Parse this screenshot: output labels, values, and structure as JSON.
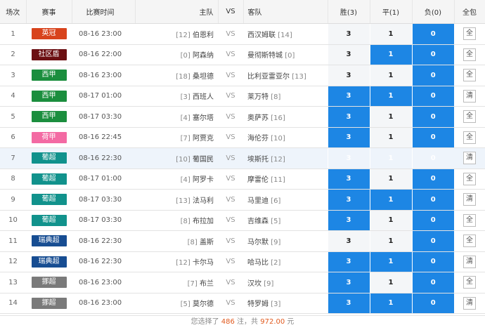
{
  "header": {
    "idx": "场次",
    "league": "赛事",
    "time": "比赛时间",
    "home": "主队",
    "vs": "VS",
    "away": "客队",
    "win": "胜(3)",
    "draw": "平(1)",
    "lose": "负(0)",
    "pack": "全包"
  },
  "colors": {
    "英冠": "#d8431c",
    "社区盾": "#6b0f12",
    "西甲": "#1b8e3e",
    "荷甲": "#f36aa3",
    "葡超": "#11928c",
    "瑞典超": "#174d92",
    "挪超": "#7a7a7a"
  },
  "rows": [
    {
      "idx": "1",
      "league": "英冠",
      "time": "08-16 23:00",
      "home_rank": "[12]",
      "home": "伯恩利",
      "vs": "VS",
      "away": "西汉姆联",
      "away_rank": "[14]",
      "w": "3",
      "d": "1",
      "l": "0",
      "sel": [
        false,
        false,
        true
      ],
      "pack": "全"
    },
    {
      "idx": "2",
      "league": "社区盾",
      "time": "08-16 22:00",
      "home_rank": "[0]",
      "home": "阿森纳",
      "vs": "VS",
      "away": "曼彻斯特城",
      "away_rank": "[0]",
      "w": "3",
      "d": "1",
      "l": "0",
      "sel": [
        false,
        true,
        true
      ],
      "pack": "全"
    },
    {
      "idx": "3",
      "league": "西甲",
      "time": "08-16 23:00",
      "home_rank": "[18]",
      "home": "桑坦德",
      "vs": "VS",
      "away": "比利亚雷亚尔",
      "away_rank": "[13]",
      "w": "3",
      "d": "1",
      "l": "0",
      "sel": [
        false,
        false,
        true
      ],
      "pack": "全"
    },
    {
      "idx": "4",
      "league": "西甲",
      "time": "08-17 01:00",
      "home_rank": "[3]",
      "home": "西班人",
      "vs": "VS",
      "away": "莱万特",
      "away_rank": "[8]",
      "w": "3",
      "d": "1",
      "l": "0",
      "sel": [
        true,
        true,
        true
      ],
      "pack": "清"
    },
    {
      "idx": "5",
      "league": "西甲",
      "time": "08-17 03:30",
      "home_rank": "[4]",
      "home": "塞尔塔",
      "vs": "VS",
      "away": "奥萨苏",
      "away_rank": "[16]",
      "w": "3",
      "d": "1",
      "l": "0",
      "sel": [
        true,
        false,
        true
      ],
      "pack": "全"
    },
    {
      "idx": "6",
      "league": "荷甲",
      "time": "08-16 22:45",
      "home_rank": "[7]",
      "home": "阿贾克",
      "vs": "VS",
      "away": "海伦芬",
      "away_rank": "[10]",
      "w": "3",
      "d": "1",
      "l": "0",
      "sel": [
        true,
        false,
        true
      ],
      "pack": "全"
    },
    {
      "idx": "7",
      "league": "葡超",
      "time": "08-16 22:30",
      "home_rank": "[10]",
      "home": "葡国民",
      "vs": "VS",
      "away": "埃斯托",
      "away_rank": "[12]",
      "w": "3",
      "d": "1",
      "l": "0",
      "sel": [
        true,
        true,
        true
      ],
      "pack": "清"
    },
    {
      "idx": "8",
      "league": "葡超",
      "time": "08-17 01:00",
      "home_rank": "[4]",
      "home": "阿罗卡",
      "vs": "VS",
      "away": "摩雷伦",
      "away_rank": "[11]",
      "w": "3",
      "d": "1",
      "l": "0",
      "sel": [
        true,
        false,
        true
      ],
      "pack": "全"
    },
    {
      "idx": "9",
      "league": "葡超",
      "time": "08-17 03:30",
      "home_rank": "[13]",
      "home": "法马利",
      "vs": "VS",
      "away": "马里迪",
      "away_rank": "[6]",
      "w": "3",
      "d": "1",
      "l": "0",
      "sel": [
        true,
        true,
        true
      ],
      "pack": "清"
    },
    {
      "idx": "10",
      "league": "葡超",
      "time": "08-17 03:30",
      "home_rank": "[8]",
      "home": "布拉加",
      "vs": "VS",
      "away": "吉维森",
      "away_rank": "[5]",
      "w": "3",
      "d": "1",
      "l": "0",
      "sel": [
        true,
        false,
        true
      ],
      "pack": "全"
    },
    {
      "idx": "11",
      "league": "瑞典超",
      "time": "08-16 22:30",
      "home_rank": "[8]",
      "home": "盖斯",
      "vs": "VS",
      "away": "马尔默",
      "away_rank": "[9]",
      "w": "3",
      "d": "1",
      "l": "0",
      "sel": [
        false,
        false,
        true
      ],
      "pack": "全"
    },
    {
      "idx": "12",
      "league": "瑞典超",
      "time": "08-16 22:30",
      "home_rank": "[12]",
      "home": "卡尔马",
      "vs": "VS",
      "away": "哈马比",
      "away_rank": "[2]",
      "w": "3",
      "d": "1",
      "l": "0",
      "sel": [
        true,
        true,
        true
      ],
      "pack": "清"
    },
    {
      "idx": "13",
      "league": "挪超",
      "time": "08-16 23:00",
      "home_rank": "[7]",
      "home": "布兰",
      "vs": "VS",
      "away": "汉坎",
      "away_rank": "[9]",
      "w": "3",
      "d": "1",
      "l": "0",
      "sel": [
        true,
        false,
        true
      ],
      "pack": "全"
    },
    {
      "idx": "14",
      "league": "挪超",
      "time": "08-16 23:00",
      "home_rank": "[5]",
      "home": "莫尔德",
      "vs": "VS",
      "away": "特罗姆",
      "away_rank": "[3]",
      "w": "3",
      "d": "1",
      "l": "0",
      "sel": [
        true,
        true,
        true
      ],
      "pack": "清"
    }
  ],
  "footer": {
    "prefix": "您选择了",
    "count": "486",
    "mid": "注，共",
    "amount": "972.00",
    "suffix": "元"
  }
}
